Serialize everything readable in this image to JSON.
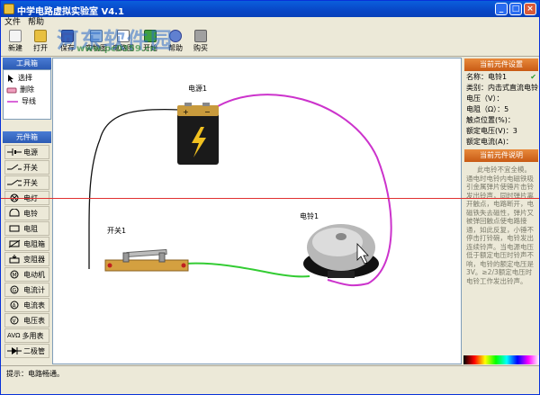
{
  "window": {
    "title": "中学电路虚拟实验室 V4.1"
  },
  "menu": [
    "文件",
    "帮助"
  ],
  "toolbar": [
    {
      "label": "新建",
      "icon": "new-file-icon"
    },
    {
      "label": "打开",
      "icon": "open-folder-icon"
    },
    {
      "label": "保存",
      "icon": "save-icon"
    },
    {
      "label": "实物图",
      "icon": "photo-icon"
    },
    {
      "label": "电路图",
      "icon": "circuit-icon"
    },
    {
      "label": "开始",
      "icon": "play-icon"
    },
    {
      "label": "帮助",
      "icon": "help-icon"
    },
    {
      "label": "购买",
      "icon": "buy-icon"
    }
  ],
  "watermark": {
    "text": "河东软件园",
    "url": "www.pc0359.cn"
  },
  "toolbox": {
    "title": "工具箱",
    "items": [
      {
        "label": "选择",
        "icon": "cursor-icon"
      },
      {
        "label": "删除",
        "icon": "eraser-icon"
      },
      {
        "label": "导线",
        "icon": "wire-icon"
      }
    ]
  },
  "components": {
    "title": "元件箱",
    "items": [
      "电源",
      "开关",
      "开关",
      "电灯",
      "电铃",
      "电阻",
      "电阻箱",
      "变阻器",
      "电动机",
      "电流计",
      "电流表",
      "电压表",
      "多用表",
      "二极管"
    ],
    "multimeter_prefix": "AVΩ"
  },
  "canvas": {
    "battery_label": "电源1",
    "switch_label": "开关1",
    "bell_label": "电铃1",
    "battery_signs": {
      "positive": "+",
      "negative": "−"
    }
  },
  "settings": {
    "title": "当前元件设置",
    "name": "名称：电铃1",
    "category": "类别：内击式直流电铃",
    "voltage": "电压（V）：",
    "resistance": "电阻（Ω）：5",
    "contact": "触点位置(%)：",
    "rated_voltage": "额定电压(V)：3",
    "rated_current": "额定电流(A)：",
    "check_mark": "✔"
  },
  "description": {
    "title": "当前元件说明",
    "text": "此电铃不宜全模。通电时电铃内电磁铁吸引金属弹片使锤片击铃发出铃声，同时弹片离开触点，电路断开，电磁铁失去磁性，弹片又被弹回触点使电路接通，如此反复，小锤不停击打铃碗，电铃发出连续铃声。当电源电压低于额定电压时铃声不响，电铃的额定电压是3V。≥2/3额定电压时电铃工作发出铃声。"
  },
  "status": {
    "text": "提示：电路畅通。"
  },
  "colors": {
    "wire_black": "#111111",
    "wire_magenta": "#cc33cc",
    "wire_green": "#33cc33",
    "title_blue": "#0846c6",
    "panel_orange": "#d8702a",
    "panel_blue": "#2c5bb4"
  }
}
